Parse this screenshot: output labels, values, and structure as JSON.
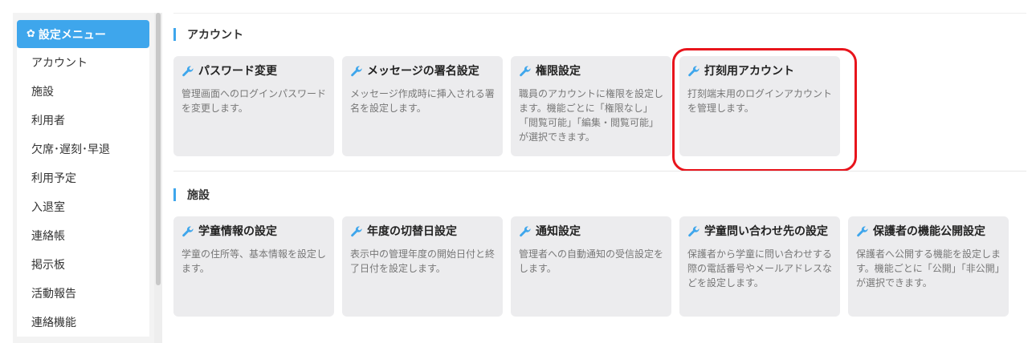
{
  "sidebar": {
    "header_label": "設定メニュー",
    "items": [
      {
        "label": "アカウント"
      },
      {
        "label": "施設"
      },
      {
        "label": "利用者"
      },
      {
        "label": "欠席･遅刻･早退"
      },
      {
        "label": "利用予定"
      },
      {
        "label": "入退室"
      },
      {
        "label": "連絡帳"
      },
      {
        "label": "掲示板"
      },
      {
        "label": "活動報告"
      },
      {
        "label": "連絡機能"
      }
    ]
  },
  "sections": [
    {
      "title": "アカウント",
      "cards": [
        {
          "title": "パスワード変更",
          "desc": "管理画面へのログインパスワードを変更します。"
        },
        {
          "title": "メッセージの署名設定",
          "desc": "メッセージ作成時に挿入される署名を設定します。"
        },
        {
          "title": "権限設定",
          "desc": "職員のアカウントに権限を設定します。機能ごとに「権限なし」「閲覧可能」「編集・閲覧可能」が選択できます。"
        },
        {
          "title": "打刻用アカウント",
          "desc": "打刻端末用のログインアカウントを管理します。"
        }
      ]
    },
    {
      "title": "施設",
      "cards": [
        {
          "title": "学童情報の設定",
          "desc": "学童の住所等、基本情報を設定します。"
        },
        {
          "title": "年度の切替日設定",
          "desc": "表示中の管理年度の開始日付と終了日付を設定します。"
        },
        {
          "title": "通知設定",
          "desc": "管理者への自動通知の受信設定をします。"
        },
        {
          "title": "学童問い合わせ先の設定",
          "desc": "保護者から学童に問い合わせする際の電話番号やメールアドレスなどを設定します。"
        },
        {
          "title": "保護者の機能公開設定",
          "desc": "保護者へ公開する機能を設定します。機能ごとに「公開」「非公開」が選択できます。"
        }
      ]
    }
  ],
  "colors": {
    "accent": "#3ea6ec",
    "highlight": "#e8141c",
    "card_bg": "#ececee"
  }
}
